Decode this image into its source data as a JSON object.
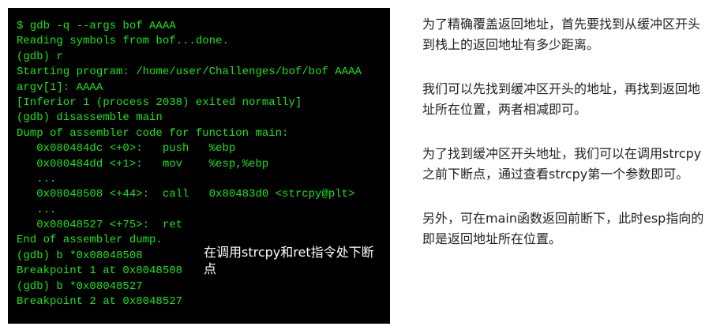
{
  "terminal": {
    "lines": [
      "$ gdb -q --args bof AAAA",
      "Reading symbols from bof...done.",
      "(gdb) r",
      "Starting program: /home/user/Challenges/bof/bof AAAA",
      "argv[1]: AAAA",
      "[Inferior 1 (process 2038) exited normally]",
      "(gdb) disassemble main",
      "Dump of assembler code for function main:",
      "   0x080484dc <+0>:   push   %ebp",
      "   0x080484dd <+1>:   mov    %esp,%ebp",
      "   ...",
      "   0x08048508 <+44>:  call   0x80483d0 <strcpy@plt>",
      "   ...",
      "   0x08048527 <+75>:  ret",
      "End of assembler dump.",
      "(gdb) b *0x08048508",
      "Breakpoint 1 at 0x8048508",
      "(gdb) b *0x08048527",
      "Breakpoint 2 at 0x8048527"
    ],
    "callout": "在调用strcpy和ret指令处下断点",
    "text_color": "#19e619",
    "background": "#000000"
  },
  "notes": [
    "为了精确覆盖返回地址，首先要找到从缓冲区开头到栈上的返回地址有多少距离。",
    "我们可以先找到缓冲区开头的地址，再找到返回地址所在位置，两者相减即可。",
    "为了找到缓冲区开头地址，我们可以在调用strcpy之前下断点，通过查看strcpy第一个参数即可。",
    "另外，可在main函数返回前断下，此时esp指向的即是返回地址所在位置。"
  ]
}
